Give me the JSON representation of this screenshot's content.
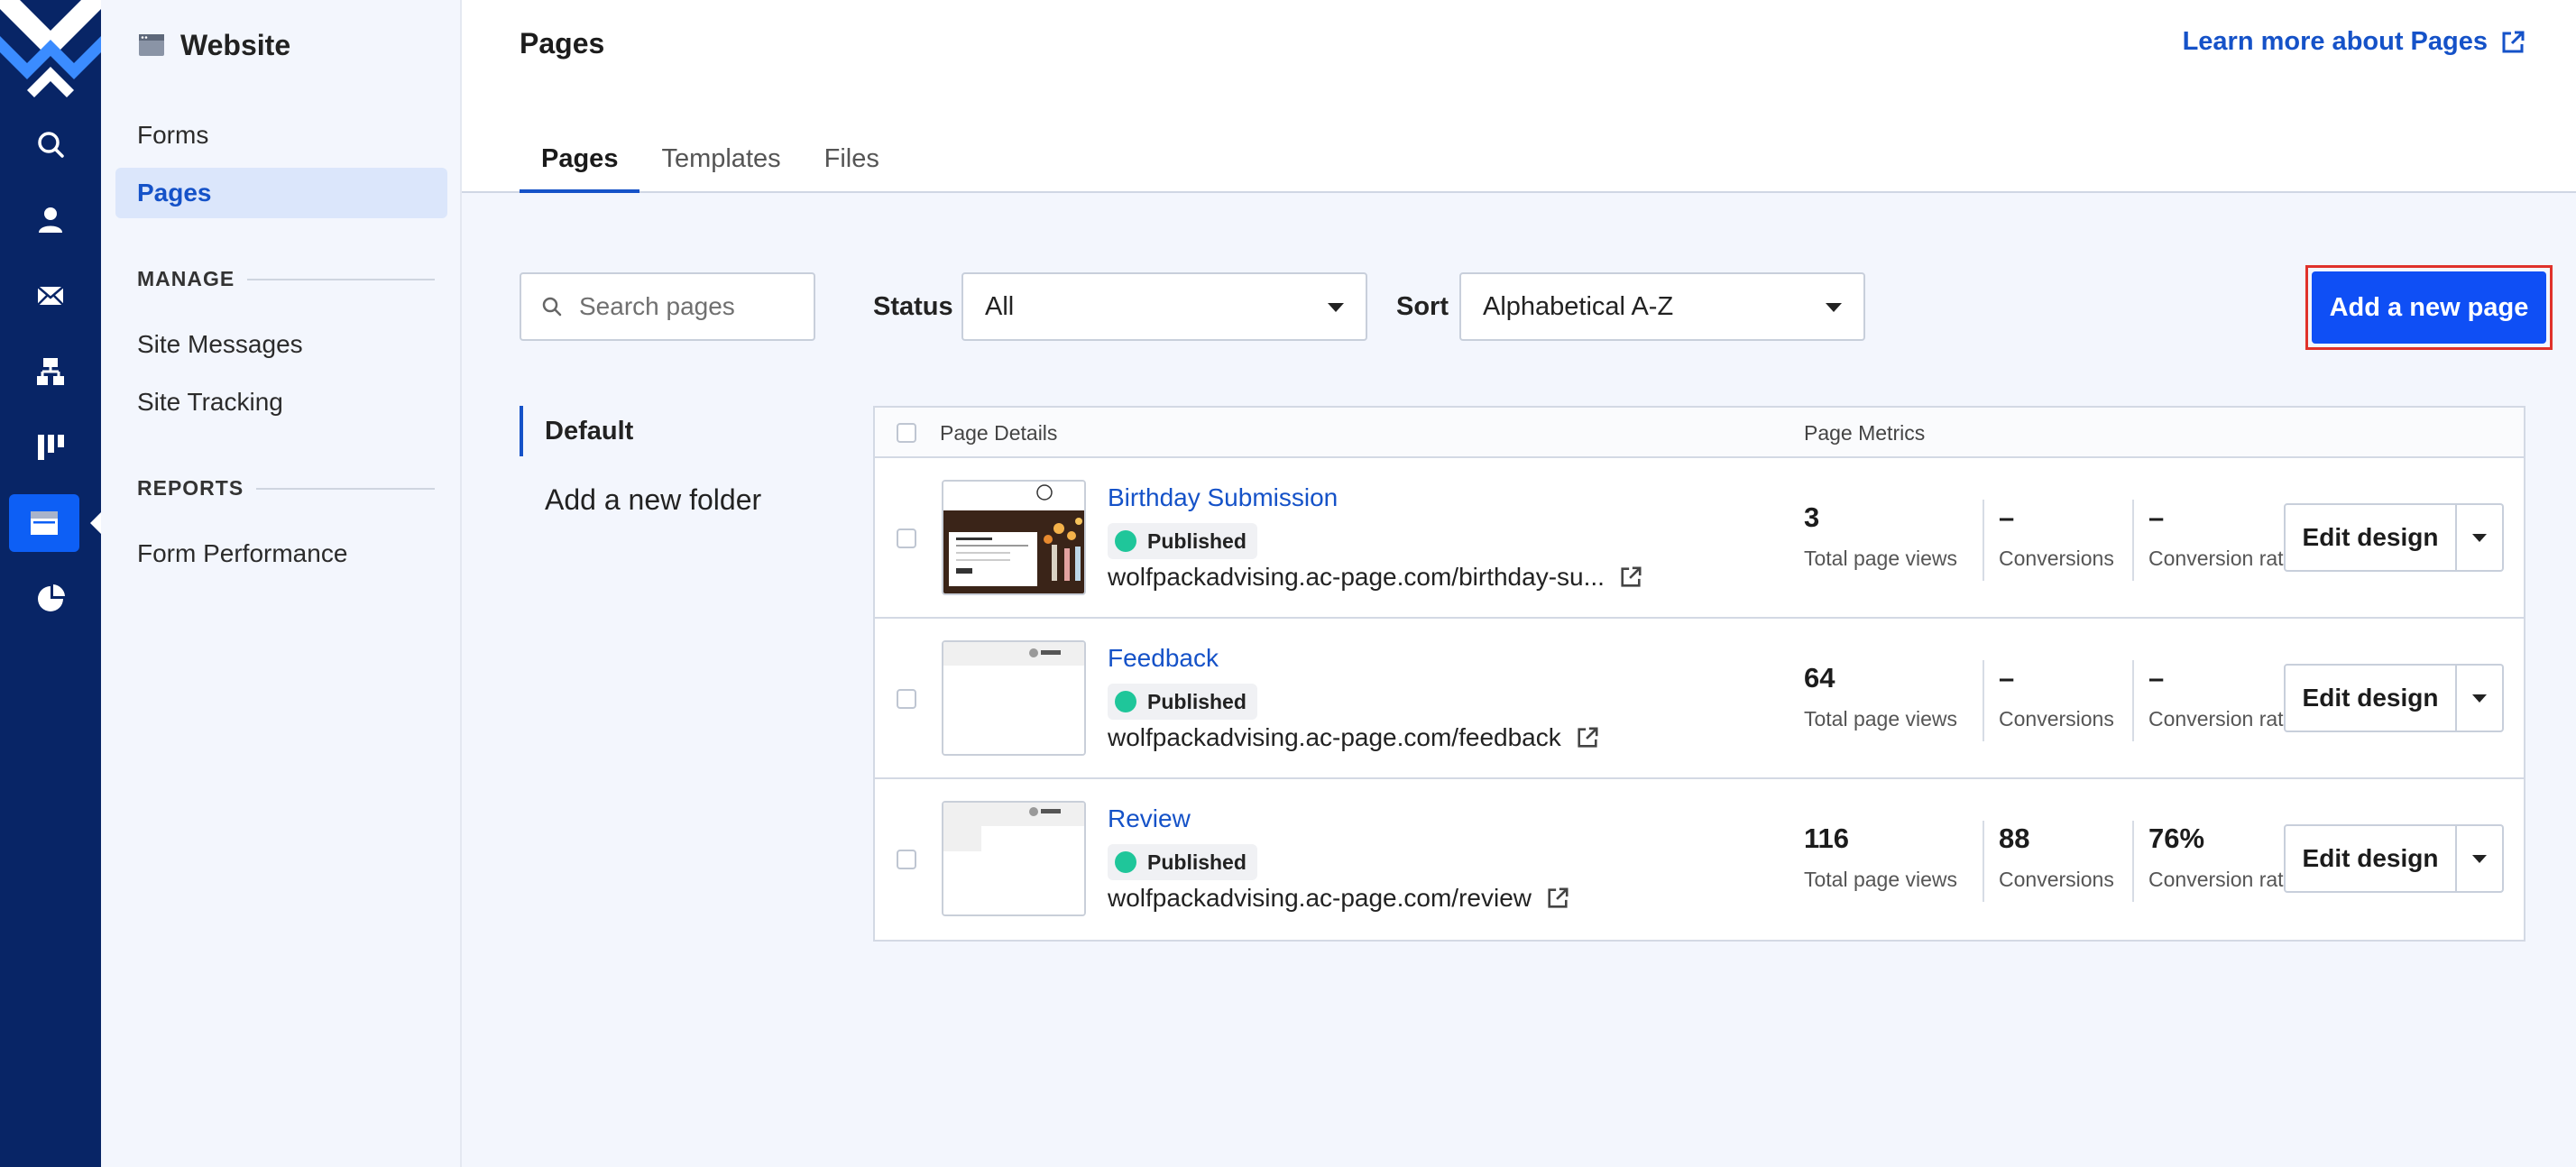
{
  "sidebar": {
    "title": "Website",
    "items": [
      {
        "label": "Forms"
      },
      {
        "label": "Pages"
      }
    ],
    "manage_heading": "MANAGE",
    "manage_items": [
      {
        "label": "Site Messages"
      },
      {
        "label": "Site Tracking"
      }
    ],
    "reports_heading": "REPORTS",
    "reports_items": [
      {
        "label": "Form Performance"
      }
    ]
  },
  "header": {
    "title": "Pages",
    "learn_link": "Learn more about Pages",
    "tabs": [
      {
        "label": "Pages"
      },
      {
        "label": "Templates"
      },
      {
        "label": "Files"
      }
    ]
  },
  "filters": {
    "search_placeholder": "Search pages",
    "status_label": "Status",
    "status_value": "All",
    "sort_label": "Sort",
    "sort_value": "Alphabetical A-Z",
    "add_button": "Add a new page"
  },
  "folders": {
    "default": "Default",
    "add": "Add a new folder"
  },
  "table": {
    "col_details": "Page Details",
    "col_metrics": "Page Metrics",
    "rows": [
      {
        "title": "Birthday Submission",
        "status": "Published",
        "url": "wolfpackadvising.ac-page.com/birthday-su...",
        "views": "3",
        "views_label": "Total page views",
        "conversions": "–",
        "conversions_label": "Conversions",
        "rate": "–",
        "rate_label": "Conversion rate",
        "edit_label": "Edit design"
      },
      {
        "title": "Feedback",
        "status": "Published",
        "url": "wolfpackadvising.ac-page.com/feedback",
        "views": "64",
        "views_label": "Total page views",
        "conversions": "–",
        "conversions_label": "Conversions",
        "rate": "–",
        "rate_label": "Conversion rate",
        "edit_label": "Edit design"
      },
      {
        "title": "Review",
        "status": "Published",
        "url": "wolfpackadvising.ac-page.com/review",
        "views": "116",
        "views_label": "Total page views",
        "conversions": "88",
        "conversions_label": "Conversions",
        "rate": "76%",
        "rate_label": "Conversion rate",
        "edit_label": "Edit design"
      }
    ]
  },
  "colors": {
    "rail": "#082566",
    "accent": "#1552c8",
    "primary_button": "#0f4ff5",
    "published": "#1fc69a",
    "highlight": "#e0322b"
  },
  "icons": {
    "rail": [
      "logo-icon",
      "search-icon",
      "contacts-icon",
      "email-icon",
      "automation-icon",
      "pipeline-icon",
      "website-icon",
      "reports-icon"
    ]
  }
}
